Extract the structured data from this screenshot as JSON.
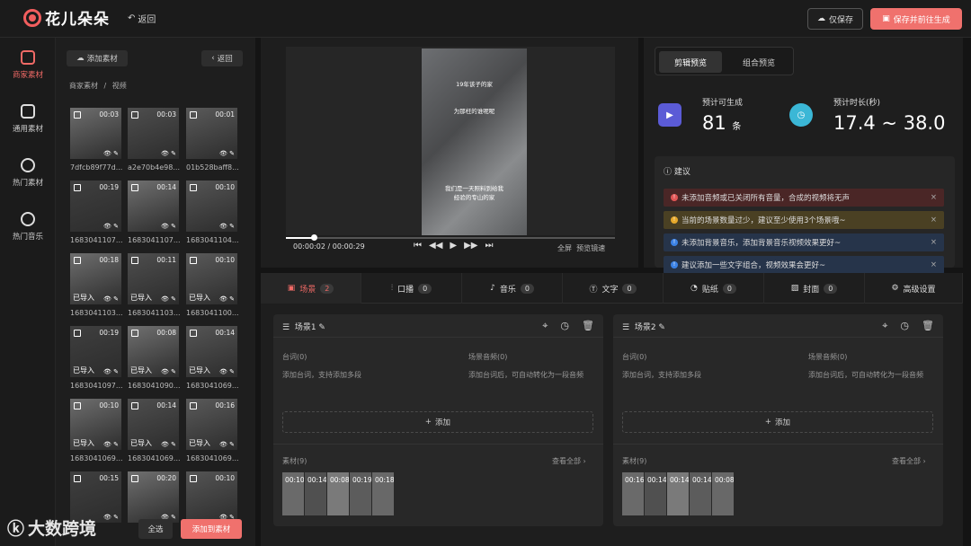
{
  "header": {
    "brand": "花儿朵朵",
    "back": "返回",
    "save_only": "仅保存",
    "save_generate": "保存并前往生成"
  },
  "rail": [
    {
      "label": "商家素材"
    },
    {
      "label": "通用素材"
    },
    {
      "label": "热门素材"
    },
    {
      "label": "热门音乐"
    }
  ],
  "library": {
    "add": "添加素材",
    "back": "返回",
    "crumb1": "商家素材",
    "crumb_sep": "/",
    "crumb2": "视频",
    "select_all": "全选",
    "add_to": "添加到素材",
    "imported": "已导入",
    "items": [
      {
        "d": "00:03",
        "n": "7dfcb89f77d...",
        "imp": false
      },
      {
        "d": "00:03",
        "n": "a2e70b4e98...",
        "imp": false
      },
      {
        "d": "00:01",
        "n": "01b528baff8...",
        "imp": false
      },
      {
        "d": "00:19",
        "n": "1683041107...",
        "imp": false
      },
      {
        "d": "00:14",
        "n": "1683041107...",
        "imp": false
      },
      {
        "d": "00:10",
        "n": "1683041104...",
        "imp": false
      },
      {
        "d": "00:18",
        "n": "1683041103...",
        "imp": true
      },
      {
        "d": "00:11",
        "n": "1683041103...",
        "imp": true
      },
      {
        "d": "00:10",
        "n": "1683041100...",
        "imp": true
      },
      {
        "d": "00:19",
        "n": "1683041097...",
        "imp": true
      },
      {
        "d": "00:08",
        "n": "1683041090...",
        "imp": true
      },
      {
        "d": "00:14",
        "n": "1683041069...",
        "imp": true
      },
      {
        "d": "00:10",
        "n": "1683041069...",
        "imp": true
      },
      {
        "d": "00:14",
        "n": "1683041069...",
        "imp": true
      },
      {
        "d": "00:16",
        "n": "1683041069...",
        "imp": true
      },
      {
        "d": "00:15",
        "n": "",
        "imp": false
      },
      {
        "d": "00:20",
        "n": "",
        "imp": false
      },
      {
        "d": "00:10",
        "n": "",
        "imp": false
      }
    ]
  },
  "player": {
    "current": "00:00:02",
    "sep": "/",
    "total": "00:00:29",
    "fullscreen": "全屏",
    "preview_mode": "预览镜速",
    "progress": 0.08,
    "cap1": "19年该子的家",
    "cap2": "为那枉的谁呢呢",
    "cap3": "我们是一天照料到给我",
    "cap4": "经验的专山的家"
  },
  "preview": {
    "tab_edit": "剪辑预览",
    "tab_combo": "组合预览",
    "gen_label": "预计可生成",
    "gen_value": "81",
    "gen_unit": "条",
    "dur_label": "预计时长(秒)",
    "dur_value": "17.4 ~ 38.0",
    "sugg_title": "建议",
    "suggestions": [
      {
        "text": "未添加音频或已关闭所有音量，合成的视频将无声",
        "color": "#e05555",
        "bg": "#4a2626"
      },
      {
        "text": "当前的场景数量过少，建议至少使用3个场景哦~",
        "color": "#e6a82a",
        "bg": "#4a4023"
      },
      {
        "text": "未添加背景音乐，添加背景音乐视频效果更好~",
        "color": "#3b82e6",
        "bg": "#26344a"
      },
      {
        "text": "建议添加一些文字组合，视频效果会更好~",
        "color": "#3b82e6",
        "bg": "#26344a"
      }
    ]
  },
  "editor": {
    "tabs": [
      {
        "label": "场景",
        "count": "2"
      },
      {
        "label": "口播",
        "count": "0"
      },
      {
        "label": "音乐",
        "count": "0"
      },
      {
        "label": "文字",
        "count": "0"
      },
      {
        "label": "贴纸",
        "count": "0"
      },
      {
        "label": "封面",
        "count": "0"
      },
      {
        "label": "高级设置",
        "count": ""
      }
    ],
    "scenes": [
      {
        "title": "场景1",
        "lines_lbl": "台词(0)",
        "lines_ph": "添加台词，支持添加多段",
        "audio_lbl": "场景音频(0)",
        "audio_ph": "添加台词后，可自动转化为一段音频",
        "add": "添加",
        "mat_lbl": "素材(9)",
        "view_all": "查看全部",
        "durs": [
          "00:10",
          "00:14",
          "00:08",
          "00:19",
          "00:18"
        ]
      },
      {
        "title": "场景2",
        "lines_lbl": "台词(0)",
        "lines_ph": "添加台词，支持添加多段",
        "audio_lbl": "场景音频(0)",
        "audio_ph": "添加台词后，可自动转化为一段音频",
        "add": "添加",
        "mat_lbl": "素材(9)",
        "view_all": "查看全部",
        "durs": [
          "00:16",
          "00:14",
          "00:14",
          "00:14",
          "00:08"
        ]
      }
    ]
  },
  "watermark": "大数跨境"
}
